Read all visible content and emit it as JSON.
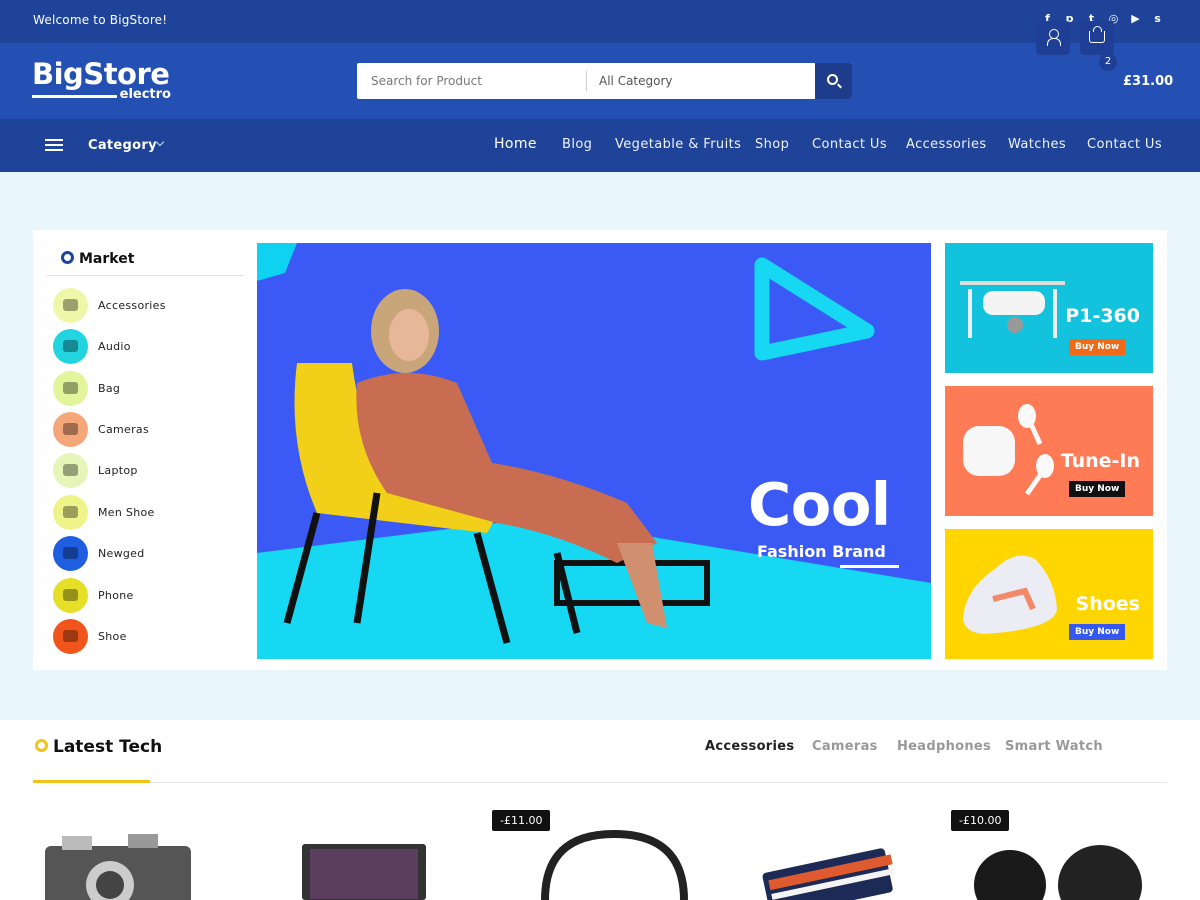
{
  "topbar": {
    "welcome": "Welcome to BigStore!",
    "socials": [
      "facebook-icon",
      "pinterest-icon",
      "twitter-icon",
      "instagram-icon",
      "youtube-icon",
      "skype-icon"
    ]
  },
  "header": {
    "logo_main": "BigStore",
    "logo_sub": "electro",
    "search_placeholder": "Search for Product",
    "category_select": "All Category",
    "cart_count": "2",
    "cart_total": "£31.00"
  },
  "nav": {
    "category_label": "Category",
    "menu": [
      "Home",
      "Blog",
      "Vegetable & Fruits",
      "Shop",
      "Contact Us",
      "Accessories",
      "Watches",
      "Contact Us"
    ]
  },
  "sidebar": {
    "title": "Market",
    "items": [
      {
        "label": "Accessories",
        "color": "#eef7a8"
      },
      {
        "label": "Audio",
        "color": "#22d3e0"
      },
      {
        "label": "Bag",
        "color": "#e2f59a"
      },
      {
        "label": "Cameras",
        "color": "#f5a77a"
      },
      {
        "label": "Laptop",
        "color": "#e6f6b8"
      },
      {
        "label": "Men Shoe",
        "color": "#eef48a"
      },
      {
        "label": "Newged",
        "color": "#1f5ee0"
      },
      {
        "label": "Phone",
        "color": "#e5e027"
      },
      {
        "label": "Shoe",
        "color": "#f0561c"
      }
    ]
  },
  "banner": {
    "headline": "Cool",
    "sub_1": "Fashion",
    "sub_2": "Brand"
  },
  "promos": [
    {
      "title": "P1-360",
      "button": "Buy Now",
      "bg": "#13c3de",
      "btn_bg": "#f06a18"
    },
    {
      "title": "Tune-In",
      "button": "Buy Now",
      "bg": "#ff7b55",
      "btn_bg": "#111111"
    },
    {
      "title": "Shoes",
      "button": "Buy Now",
      "bg": "#ffd600",
      "btn_bg": "#3758f0"
    }
  ],
  "latest": {
    "title": "Latest Tech",
    "tabs": [
      "Accessories",
      "Cameras",
      "Headphones",
      "Smart Watch"
    ],
    "discounts": [
      "-£11.00",
      "-£10.00"
    ]
  },
  "colors": {
    "topbar": "#1f4399",
    "header": "#2450b4",
    "accent_yellow": "#f2c417"
  }
}
